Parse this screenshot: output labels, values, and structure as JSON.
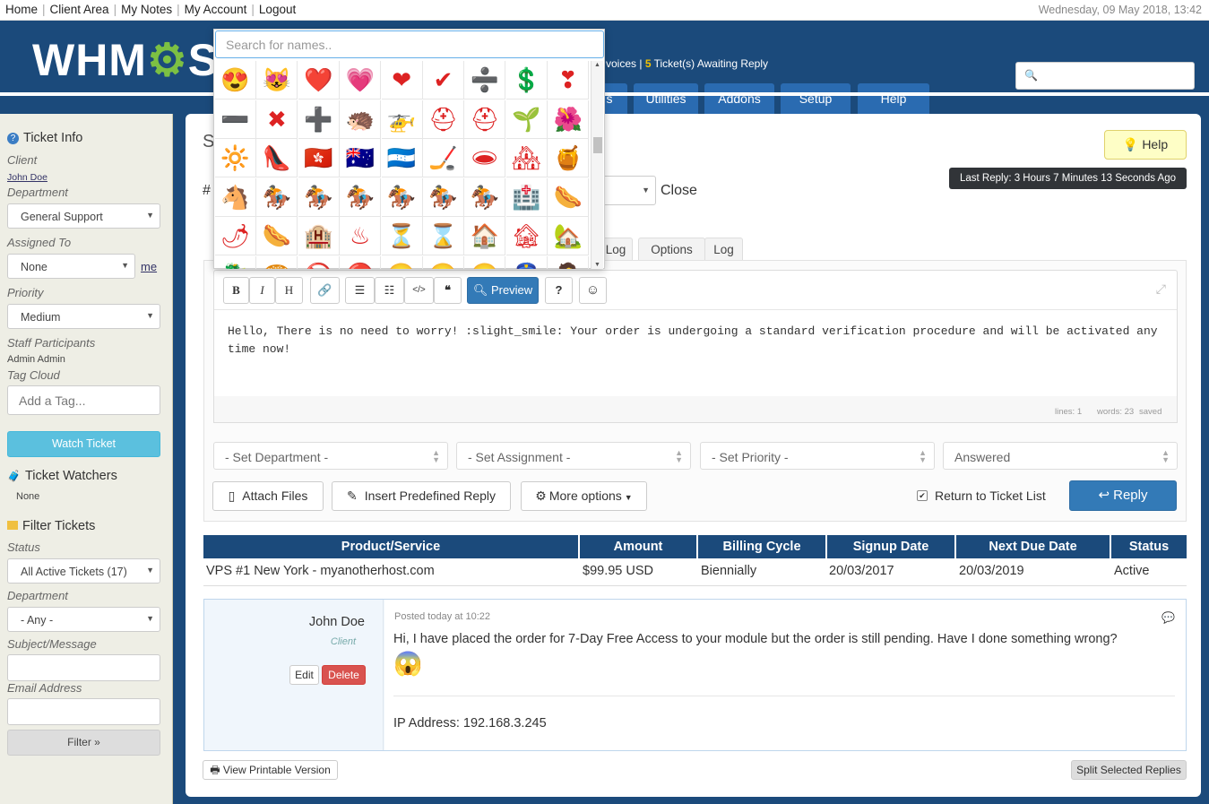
{
  "topbar": {
    "nav": [
      "Home",
      "Client Area",
      "My Notes",
      "My Account",
      "Logout"
    ],
    "date": "Wednesday, 09 May 2018, 13:42"
  },
  "header": {
    "logo": "WHMCS",
    "info_prefix": "voices |",
    "awaiting_count": "5",
    "awaiting_text": "Ticket(s) Awaiting Reply",
    "nav_tabs": [
      "s",
      "Utilities",
      "Addons",
      "Setup",
      "Help"
    ]
  },
  "sidebar": {
    "ticket_info_title": "Ticket Info",
    "client_label": "Client",
    "client_name": "John Doe",
    "department_label": "Department",
    "department_value": "General Support",
    "assigned_label": "Assigned To",
    "assigned_value": "None",
    "assign_me": "me",
    "priority_label": "Priority",
    "priority_value": "Medium",
    "staff_label": "Staff Participants",
    "staff_value": "Admin Admin",
    "tag_label": "Tag Cloud",
    "tag_placeholder": "Add a Tag...",
    "watch_button": "Watch Ticket",
    "watchers_title": "Ticket Watchers",
    "watchers_value": "None",
    "filter_title": "Filter Tickets",
    "status_label": "Status",
    "status_value": "All Active Tickets (17)",
    "filter_dept_label": "Department",
    "filter_dept_value": "- Any -",
    "subject_label": "Subject/Message",
    "email_label": "Email Address",
    "filter_button": "Filter »"
  },
  "main": {
    "title_fragment": "S",
    "hash_fragment": "#",
    "close_label": "Close",
    "help_button": "Help",
    "last_reply": "Last Reply: 3 Hours 7 Minutes 13 Seconds Ago",
    "tabs": [
      "Log",
      "Options",
      "Log"
    ],
    "toolbar": {
      "bold": "B",
      "italic": "I",
      "heading": "H",
      "preview": "Preview"
    },
    "editor_text": "Hello, There is no need to worry! :slight_smile: Your order is undergoing a standard verification procedure and will be activated any time now!",
    "editor_footer": {
      "lines": "lines: 1",
      "words": "words: 23",
      "saved": "saved"
    },
    "set_department": "- Set Department -",
    "set_assignment": "- Set Assignment -",
    "set_priority": "- Set Priority -",
    "status_select": "Answered",
    "attach_files": "Attach Files",
    "insert_predefined": "Insert Predefined Reply",
    "more_options": "More options",
    "return_to_list": "Return to Ticket List",
    "reply_button": "Reply"
  },
  "products": {
    "headers": [
      "Product/Service",
      "Amount",
      "Billing Cycle",
      "Signup Date",
      "Next Due Date",
      "Status"
    ],
    "row": [
      "VPS #1 New York - myanotherhost.com",
      "$99.95 USD",
      "Biennially",
      "20/03/2017",
      "20/03/2019",
      "Active"
    ]
  },
  "reply": {
    "author": "John Doe",
    "role": "Client",
    "edit": "Edit",
    "delete": "Delete",
    "posted": "Posted today at 10:22",
    "message": "Hi, I have placed the order for 7-Day Free Access to your module but the order is still pending. Have I done something wrong?",
    "emoji": "😱",
    "ip": "IP Address: 192.168.3.245"
  },
  "footer": {
    "printable": "View Printable Version",
    "split": "Split Selected Replies"
  },
  "emoji_picker": {
    "placeholder": "Search for names..",
    "rows": [
      [
        "😍",
        "😻",
        "❤️",
        "💗",
        "❤",
        "✔",
        "➗",
        "💲",
        "❣"
      ],
      [
        "➖",
        "✖",
        "➕",
        "🦔",
        "🚁",
        "⛑",
        "⛑",
        "🌱",
        "🌺"
      ],
      [
        "🔆",
        "👠",
        "🇭🇰",
        "🇭🇲",
        "🇭🇳",
        "🏒",
        "🕳",
        "🏘",
        "🍯"
      ],
      [
        "🐴",
        "🏇",
        "🏇",
        "🏇",
        "🏇",
        "🏇",
        "🏇",
        "🏥",
        "🌭"
      ],
      [
        "🌶",
        "🌭",
        "🏨",
        "♨",
        "⏳",
        "⌛",
        "🏠",
        "🏚",
        "🏡"
      ],
      [
        "🐉",
        "🥯",
        "🚫",
        "🔴",
        "😀",
        "😃",
        "😁",
        "👮",
        "🤷"
      ]
    ]
  }
}
